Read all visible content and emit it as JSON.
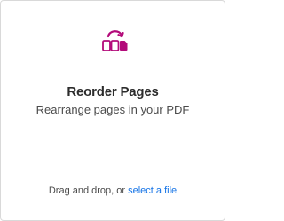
{
  "card": {
    "title": "Reorder Pages",
    "subtitle": "Rearrange pages in your PDF",
    "icon": "reorder-pages-icon",
    "accent_color": "#b30b7a"
  },
  "dropzone": {
    "prefix": "Drag and drop, or",
    "link_label": "select a file",
    "link_color": "#1473e6"
  }
}
